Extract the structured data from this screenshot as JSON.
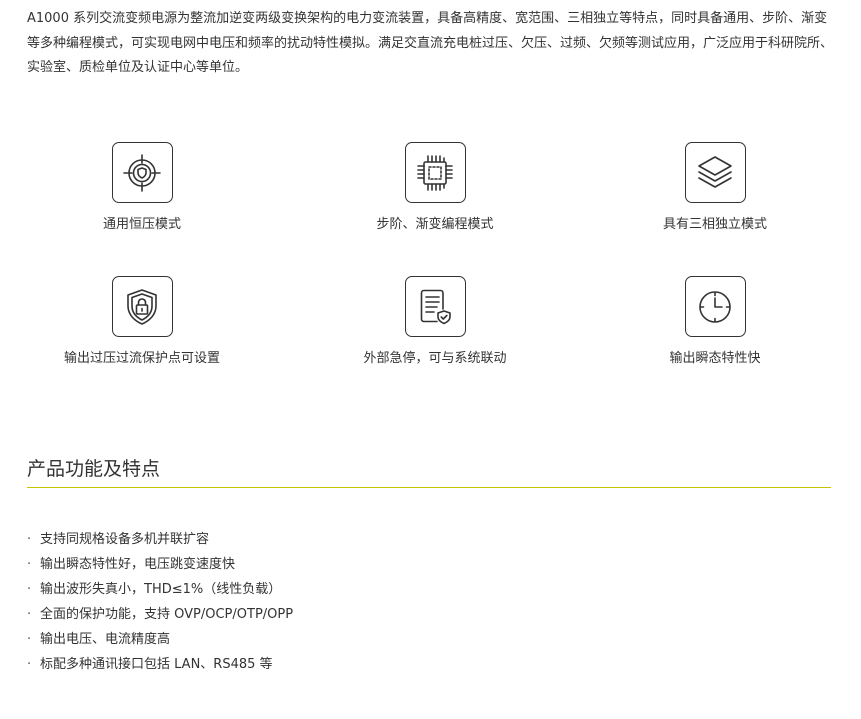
{
  "intro": {
    "text": "A1000 系列交流变频电源为整流加逆变两级变换架构的电力变流装置，具备高精度、宽范围、三相独立等特点，同时具备通用、步阶、渐变等多种编程模式，可实现电网中电压和频率的扰动特性模拟。满足交直流充电桩过压、欠压、过频、欠频等测试应用，广泛应用于科研院所、实验室、质检单位及认证中心等单位。"
  },
  "features": [
    {
      "label": "通用恒压模式",
      "icon": "target-shield-icon"
    },
    {
      "label": "步阶、渐变编程模式",
      "icon": "chip-icon"
    },
    {
      "label": "具有三相独立模式",
      "icon": "layers-icon"
    },
    {
      "label": "输出过压过流保护点可设置",
      "icon": "shield-lock-icon"
    },
    {
      "label": "外部急停，可与系统联动",
      "icon": "document-check-icon"
    },
    {
      "label": "输出瞬态特性快",
      "icon": "clock-icon"
    }
  ],
  "section": {
    "title": "产品功能及特点",
    "line_color": "#c9c400"
  },
  "bullets": [
    "支持同规格设备多机并联扩容",
    "输出瞬态特性好，电压跳变速度快",
    "输出波形失真小，THD≤1%（线性负载）",
    "全面的保护功能，支持 OVP/OCP/OTP/OPP",
    "输出电压、电流精度高",
    "标配多种通讯接口包括 LAN、RS485 等"
  ]
}
